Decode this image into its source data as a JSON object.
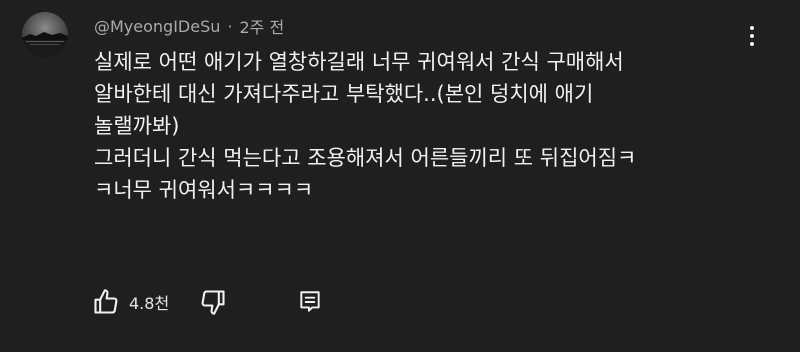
{
  "comment": {
    "author": "@MyeongIDeSu",
    "separator": "·",
    "time": "2주 전",
    "lines": [
      "실제로 어떤 애기가 열창하길래 너무 귀여워서 간식 구매해서",
      "알바한테 대신 가져다주라고 부탁했다..(본인 덩치에 애기",
      "놀랠까봐)",
      "그러더니 간식 먹는다고 조용해져서 어른들끼리 또 뒤집어짐ㅋ",
      "ㅋ너무 귀여워서ㅋㅋㅋㅋ"
    ],
    "like_count": "4.8천"
  },
  "icons": {
    "avatar": "avatar-image",
    "more": "more-vertical-icon",
    "like": "thumbs-up-icon",
    "dislike": "thumbs-down-icon",
    "reply": "reply-comment-icon"
  },
  "colors": {
    "background": "#1f1f1f",
    "text": "#f1f1f1",
    "meta": "#aaaaaa"
  }
}
